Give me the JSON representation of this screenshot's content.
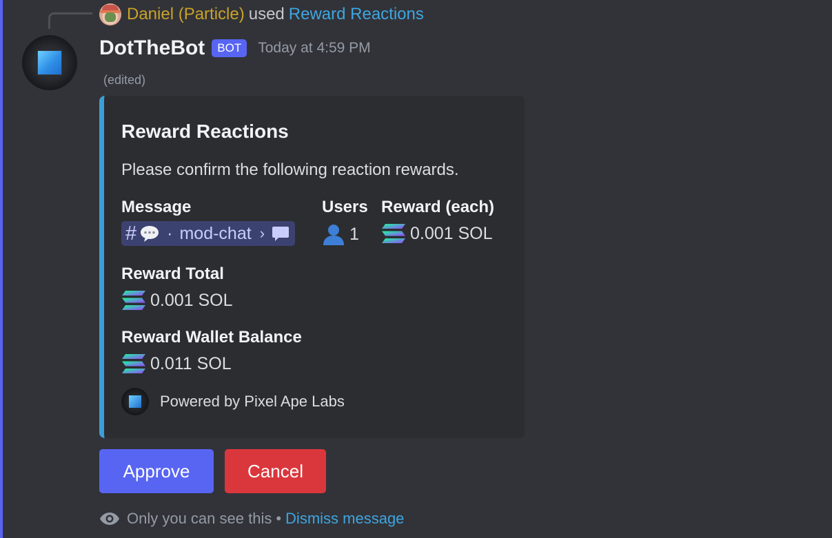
{
  "reply": {
    "user_name": "Daniel (Particle)",
    "used_text": "used",
    "command": "Reward Reactions"
  },
  "message": {
    "author": "DotTheBot",
    "badge": "BOT",
    "timestamp": "Today at 4:59 PM",
    "edited": "(edited)"
  },
  "embed": {
    "accent_color": "#3b9ed8",
    "title": "Reward Reactions",
    "description": "Please confirm the following reaction rewards.",
    "fields": {
      "message": {
        "name": "Message",
        "channel_hash": "#",
        "separator": "·",
        "channel_name": "mod-chat",
        "chevron": "›"
      },
      "users": {
        "name": "Users",
        "value": "1"
      },
      "reward_each": {
        "name": "Reward (each)",
        "value": "0.001 SOL"
      },
      "reward_total": {
        "name": "Reward Total",
        "value": "0.001 SOL"
      },
      "wallet_balance": {
        "name": "Reward Wallet Balance",
        "value": "0.011 SOL"
      }
    },
    "footer": "Powered by Pixel Ape Labs"
  },
  "buttons": {
    "approve": "Approve",
    "cancel": "Cancel"
  },
  "ephemeral": {
    "note": "Only you can see this",
    "bullet": "•",
    "dismiss": "Dismiss message"
  },
  "icons": {
    "reply_avatar": "pixel-ape-avatar-icon",
    "bot_avatar": "blue-square-avatar-icon",
    "speech": "speech-bubble-icon",
    "thread": "thread-icon",
    "user": "user-silhouette-icon",
    "sol": "solana-icon",
    "eye": "eye-icon"
  },
  "colors": {
    "blurple": "#5865f2",
    "danger": "#da373c",
    "link": "#3ea6e0",
    "reply_name": "#c9a227"
  }
}
